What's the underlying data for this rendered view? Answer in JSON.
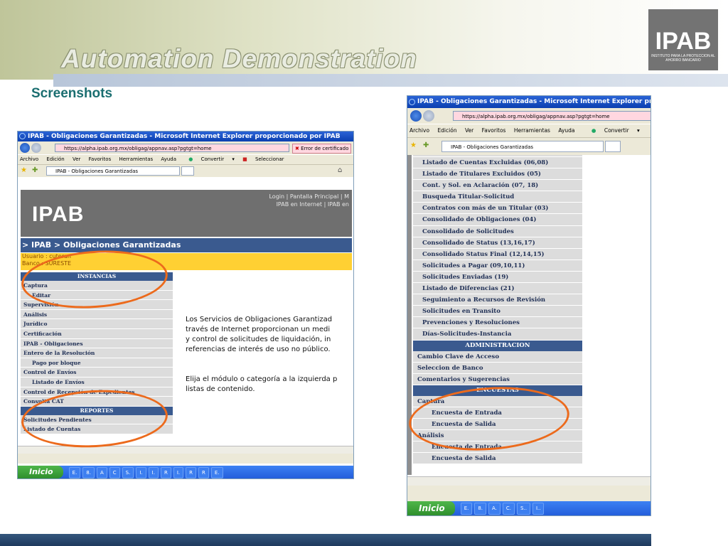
{
  "slide": {
    "title": "Automation Demonstration",
    "subtitle": "Screenshots",
    "logo_text": "IPAB",
    "logo_caption": "INSTITUTO PARA LA PROTECCION AL AHORRO BANCARIO"
  },
  "left": {
    "window_title": "IPAB - Obligaciones Garantizadas - Microsoft Internet Explorer proporcionado por IPAB",
    "url": "https://alpha.ipab.org.mx/obligag/appnav.asp?pgtgt=home",
    "cert_error": "Error de certificado",
    "menu": [
      "Archivo",
      "Edición",
      "Ver",
      "Favoritos",
      "Herramientas",
      "Ayuda"
    ],
    "convert_label": "Convertir",
    "select_label": "Seleccionar",
    "tab_label": "IPAB - Obligaciones Garantizadas",
    "brand": "IPAB",
    "links_line1": "Login | Pantalla Principal | M",
    "links_line2": "IPAB en Internet | IPAB en",
    "breadcrumb": "> IPAB > Obligaciones Garantizadas",
    "user_line": "Usuario : cuteran",
    "bank_line": "Banco   : SURESTE",
    "section_instancias": "INSTANCIAS",
    "items_instancias": [
      {
        "label": "Captura",
        "sub": false
      },
      {
        "label": "Editar",
        "sub": true
      },
      {
        "label": "Supervisión",
        "sub": false
      },
      {
        "label": "Análisis",
        "sub": false
      },
      {
        "label": "Jurídico",
        "sub": false
      },
      {
        "label": "Certificación",
        "sub": false
      },
      {
        "label": "IPAB - Obligaciones",
        "sub": false
      },
      {
        "label": "Entero de la Resolución",
        "sub": false
      },
      {
        "label": "Pago por bloque",
        "sub": true
      },
      {
        "label": "Control de Envíos",
        "sub": false
      },
      {
        "label": "Listado de Envíos",
        "sub": true
      },
      {
        "label": "Control de Recepción de Expedientes",
        "sub": false
      },
      {
        "label": "Consulta CAT",
        "sub": false
      }
    ],
    "section_reportes": "REPORTES",
    "items_reportes": [
      "Solicitudes Pendientes",
      "Listado de Cuentas"
    ],
    "content_p1": [
      "Los Servicios de Obligaciones Garantizad",
      "través de Internet proporcionan un medi",
      "y control de solicitudes de liquidación, in",
      "referencias de interés de uso no público."
    ],
    "content_p2": [
      "Elija el módulo o categoría a la izquierda p",
      "listas de contenido."
    ],
    "start_label": "Inicio",
    "taskbar_items": [
      "E.",
      "8.",
      "A",
      "C",
      "S.",
      "I.",
      "I.",
      "R",
      "I.",
      "R",
      "R",
      "E."
    ]
  },
  "right": {
    "window_title": "IPAB - Obligaciones Garantizadas - Microsoft Internet Explorer propo",
    "url": "https://alpha.ipab.org.mx/obligag/appnav.asp?pgtgt=home",
    "menu": [
      "Archivo",
      "Edición",
      "Ver",
      "Favoritos",
      "Herramientas",
      "Ayuda"
    ],
    "convert_label": "Convertir",
    "tab_label": "IPAB - Obligaciones Garantizadas",
    "reports": [
      "Listado de Cuentas Excluidas  (06,08)",
      "Listado de Titulares Excluidos  (05)",
      "Cont. y Sol. en Aclaración  (07, 18)",
      "Busqueda Titular-Solicitud",
      "Contratos con más de un Titular  (03)",
      "Consolidado de Obligaciones  (04)",
      "Consolidado de Solicitudes",
      "Consolidado de Status  (13,16,17)",
      "Consolidado Status Final  (12,14,15)",
      "Solicitudes a Pagar  (09,10,11)",
      "Solicitudes Enviadas  (19)",
      "Listado de Diferencias  (21)",
      "Seguimiento a Recursos de Revisión",
      "Solicitudes en Transito",
      "Prevenciones y Resoluciones",
      "Días-Solicitudes-Instancia"
    ],
    "section_admin": "ADMINISTRACION",
    "admin_items": [
      "Cambio Clave de Acceso",
      "Seleccion de Banco",
      "Comentarios y Sugerencias"
    ],
    "section_encuestas": "ENCUESTAS",
    "enc_captura": "Captura",
    "enc_captura_items": [
      "Encuesta de Entrada",
      "Encuesta de Salida"
    ],
    "enc_analisis": "Análisis",
    "enc_analisis_items": [
      "Encuesta de Entrada",
      "Encuesta de Salida"
    ],
    "start_label": "Inicio",
    "taskbar_items": [
      "E.",
      "8.",
      "A.",
      "C.",
      "S..",
      "I.."
    ]
  },
  "colors": {
    "accent_blue": "#3a5a8f",
    "highlight_orange": "#ec6a1c",
    "user_bar_yellow": "#ffd033"
  }
}
